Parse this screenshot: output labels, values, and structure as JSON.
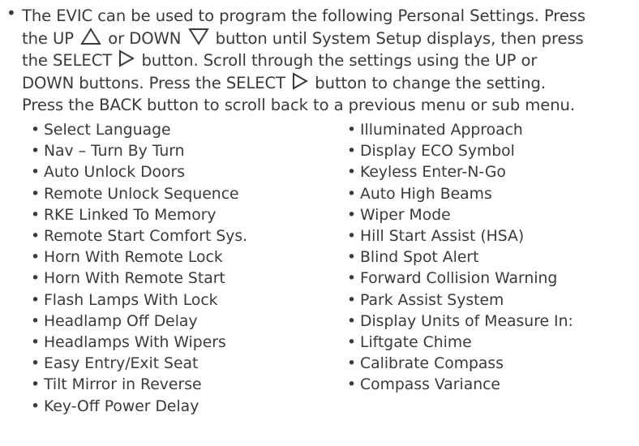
{
  "intro": {
    "lines": [
      [
        "The EVIC can be used to program the following Personal Settings. Press"
      ],
      [
        "the UP ",
        "up-triangle-icon",
        " or DOWN ",
        "down-triangle-icon",
        " button until System Setup displays, then press"
      ],
      [
        "the SELECT ",
        "right-triangle-icon",
        " button. Scroll through the settings using the UP or"
      ],
      [
        "DOWN buttons. Press the SELECT ",
        "right-triangle-icon",
        " button to change the setting."
      ],
      [
        "Press the BACK button to scroll back to a previous menu or sub menu."
      ]
    ],
    "seg": {
      "l1": "The EVIC can be used to program the following Personal Settings. Press",
      "l2a": "the UP",
      "l2b": "or DOWN",
      "l2c": "button until System Setup displays, then press",
      "l3a": "the SELECT",
      "l3b": "button. Scroll through the settings using the UP or",
      "l4a": "DOWN buttons. Press the SELECT",
      "l4b": "button to change the setting.",
      "l5": "Press the BACK button to scroll back to a previous menu or sub menu."
    }
  },
  "bullet": "•",
  "left_items": [
    "Select Language",
    "Nav – Turn By Turn",
    "Auto Unlock Doors",
    "Remote Unlock Sequence",
    "RKE Linked To Memory",
    "Remote Start Comfort Sys.",
    "Horn With Remote Lock",
    "Horn With Remote Start",
    "Flash Lamps With Lock",
    "Headlamp Off Delay",
    "Headlamps With Wipers",
    "Easy Entry/Exit Seat",
    "Tilt Mirror in Reverse",
    "Key-Off Power Delay"
  ],
  "right_items": [
    "Illuminated Approach",
    "Display ECO Symbol",
    "Keyless Enter-N-Go",
    "Auto High Beams",
    "Wiper Mode",
    "Hill Start Assist (HSA)",
    "Blind Spot Alert",
    "Forward Collision Warning",
    "Park Assist System",
    "Display Units of Measure In:",
    "Liftgate Chime",
    "Calibrate Compass",
    "Compass Variance"
  ],
  "icons": {
    "up": "up-triangle-icon",
    "down": "down-triangle-icon",
    "select": "right-triangle-icon"
  },
  "colors": {
    "text": "#3a3a3a",
    "background": "#ffffff"
  }
}
